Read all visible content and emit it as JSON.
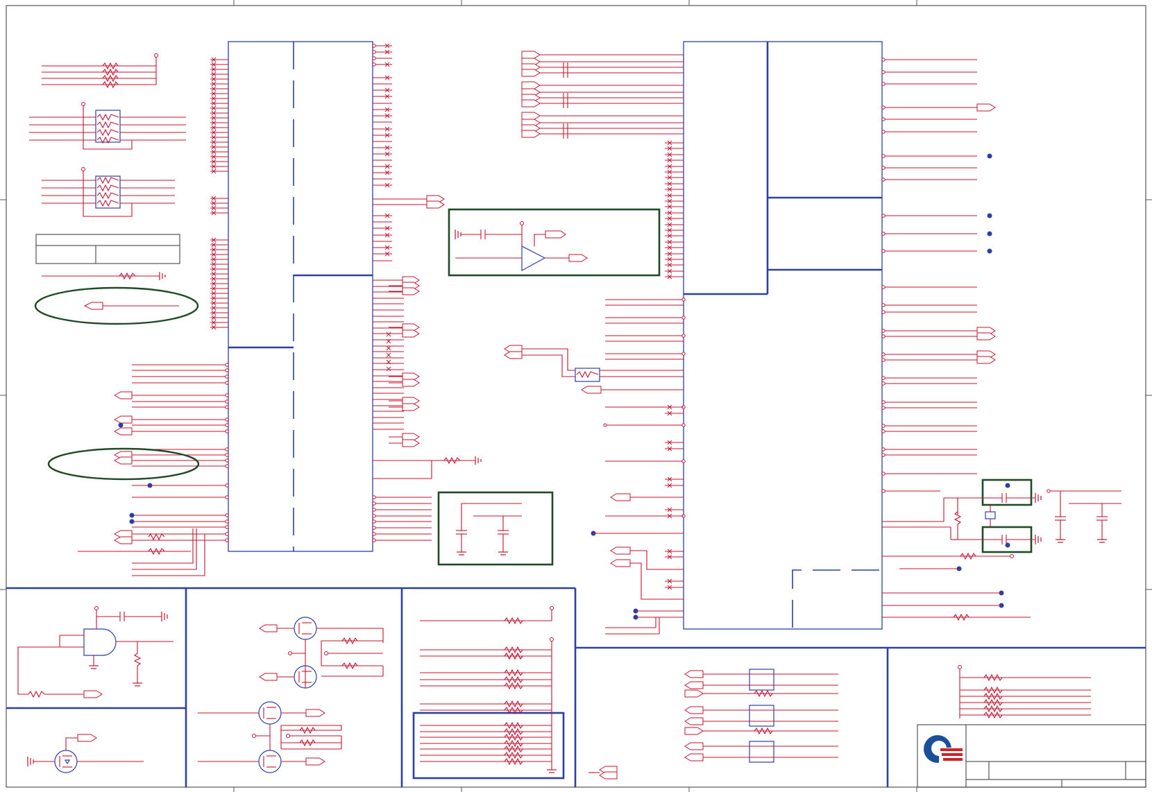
{
  "sheet": {
    "title_block": {
      "logo": "company-logo-mark",
      "fields": [
        "",
        "",
        "",
        ""
      ]
    },
    "colors": {
      "wire": "#c8102e",
      "block_outline": "#2a3fa8",
      "highlight_box": "#1f4a26",
      "junction": "#2a3fa8",
      "logo_blue": "#1b4f9c",
      "logo_red": "#d0202a",
      "background": "#ffffff"
    },
    "regions": [
      "left-pullup-networks",
      "chip-u1",
      "chip-u2",
      "buffer-circuit",
      "decoupling-caps",
      "crystal-circuit",
      "and-gate-circuit",
      "mosfet-switch-circuit",
      "pullup-resistor-bank",
      "resistor-network-group-bottom",
      "resistor-network-group-right"
    ]
  }
}
